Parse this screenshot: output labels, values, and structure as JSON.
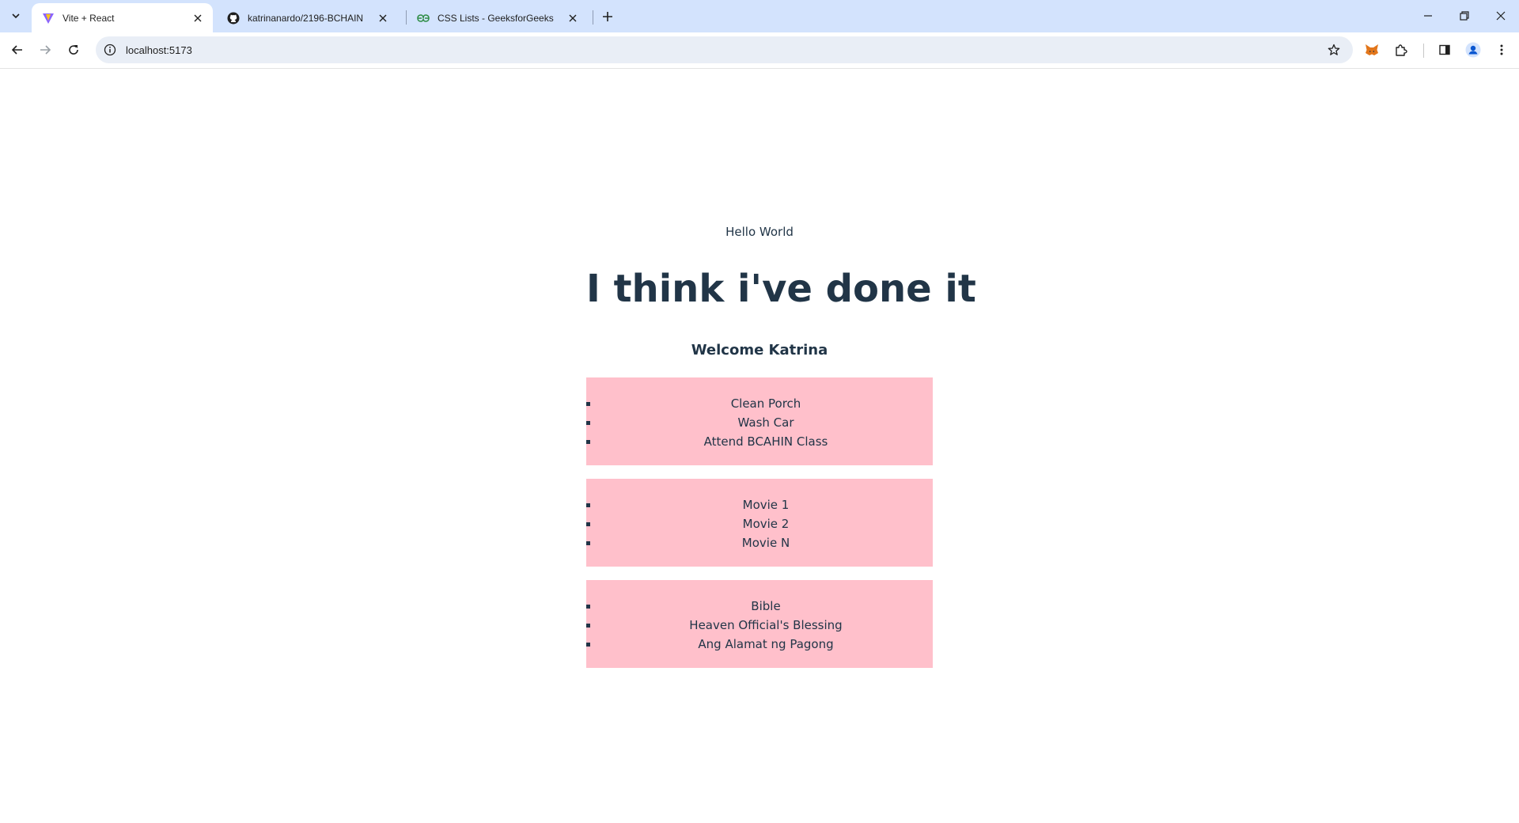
{
  "browser": {
    "tabs": [
      {
        "title": "Vite + React",
        "favicon": "vite-icon",
        "active": true
      },
      {
        "title": "katrinanardo/2196-BCHAIN",
        "favicon": "github-icon",
        "active": false
      },
      {
        "title": "CSS Lists - GeeksforGeeks",
        "favicon": "geeksforgeeks-icon",
        "active": false
      }
    ],
    "url": "localhost:5173"
  },
  "page": {
    "greeting": "Hello World",
    "headline": "I think i've done it",
    "welcome": "Welcome Katrina",
    "lists": [
      {
        "items": [
          "Clean Porch",
          "Wash Car",
          "Attend BCAHIN Class"
        ]
      },
      {
        "items": [
          "Movie 1",
          "Movie 2",
          "Movie N"
        ]
      },
      {
        "items": [
          "Bible",
          "Heaven Official's Blessing",
          "Ang Alamat ng Pagong"
        ]
      }
    ]
  },
  "colors": {
    "tabstrip": "#d3e3fd",
    "list_background": "#ffc0cb",
    "text": "#213547"
  }
}
